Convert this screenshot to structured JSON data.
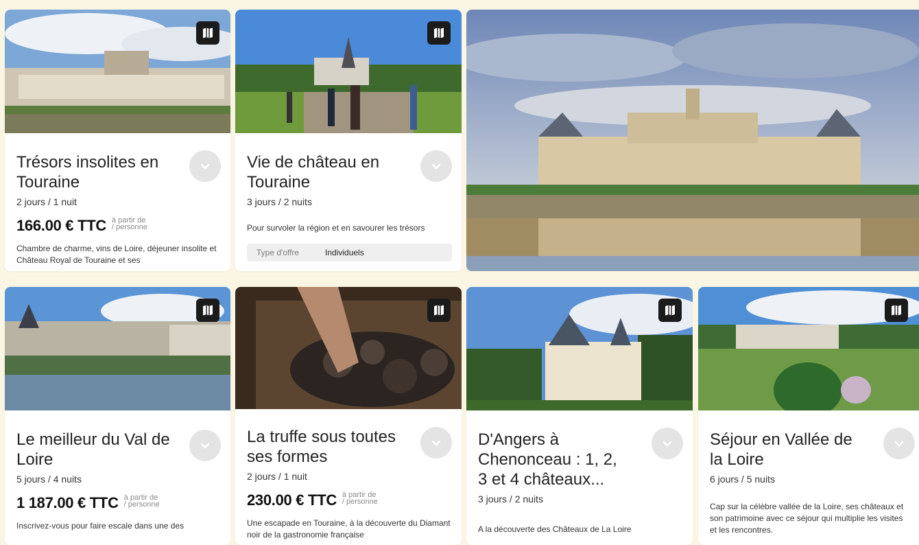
{
  "cards": [
    {
      "title": "Trésors insolites en Touraine",
      "duration": "2 jours / 1 nuit",
      "price": "166.00 € TTC",
      "price_note_1": "à partir de",
      "price_note_2": "/ personne",
      "description": "Chambre de charme, vins de Loire, déjeuner insolite et Château Royal de Touraine et ses"
    },
    {
      "title": "Vie de château en Touraine",
      "duration": "3 jours / 2 nuits",
      "description": "Pour survoler la région et en savourer les trésors",
      "offer_label": "Type d'offre",
      "offer_value": "Individuels"
    },
    {
      "title": "Le meilleur du Val de Loire",
      "duration": "5 jours / 4 nuits",
      "price": "1 187.00 € TTC",
      "price_note_1": "à partir de",
      "price_note_2": "/ personne",
      "description": "Inscrivez-vous pour faire escale dans une des"
    },
    {
      "title": "La truffe sous toutes ses formes",
      "duration": "2 jours / 1 nuit",
      "price": "230.00 € TTC",
      "price_note_1": "à partir de",
      "price_note_2": "/ personne",
      "description": "Une escapade en Touraine, à la découverte du Diamant noir de la gastronomie française"
    },
    {
      "title": "D'Angers à Chenonceau : 1, 2, 3 et 4 châteaux...",
      "duration": "3 jours / 2 nuits",
      "description": "A la découverte des Châteaux de La Loire"
    },
    {
      "title": "Séjour en Vallée de la Loire",
      "duration": "6 jours / 5 nuits",
      "description": "Cap sur la célèbre vallée de la Loire, ses châteaux et son patrimoine avec ce séjour qui multiplie les visites et les rencontres."
    }
  ],
  "colors": {
    "page_background": "#fbf6e3",
    "card_background": "#ffffff",
    "map_button": "#1b1b1b",
    "toggle": "#e4e4e4"
  },
  "icons": {
    "map": "folded-map-icon",
    "toggle": "chevron-down-icon"
  }
}
